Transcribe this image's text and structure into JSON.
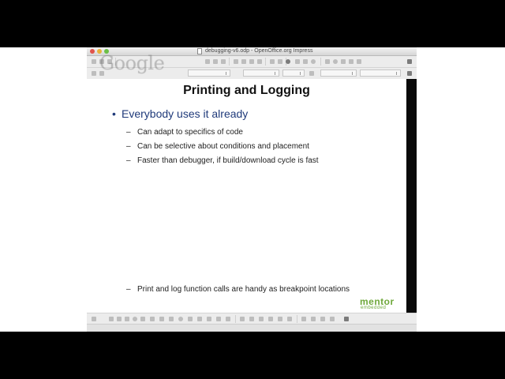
{
  "window": {
    "title": "debugging-v6.odp - OpenOffice.org Impress",
    "watermark": "Google"
  },
  "slide": {
    "title": "Printing and Logging",
    "bullet": "Everybody uses it already",
    "bullet_marker": "•",
    "sub_marker": "–",
    "sub_items": [
      "Can adapt to specifics of code",
      "Can be selective about conditions and placement",
      "Faster than debugger, if build/download cycle is fast"
    ],
    "bottom_item": "Print and log function calls are handy as breakpoint locations",
    "logo": {
      "line1": "mentor",
      "line2": "embedded"
    }
  },
  "colors": {
    "bullet": "#1f3a7a",
    "logo": "#6fa83b"
  }
}
